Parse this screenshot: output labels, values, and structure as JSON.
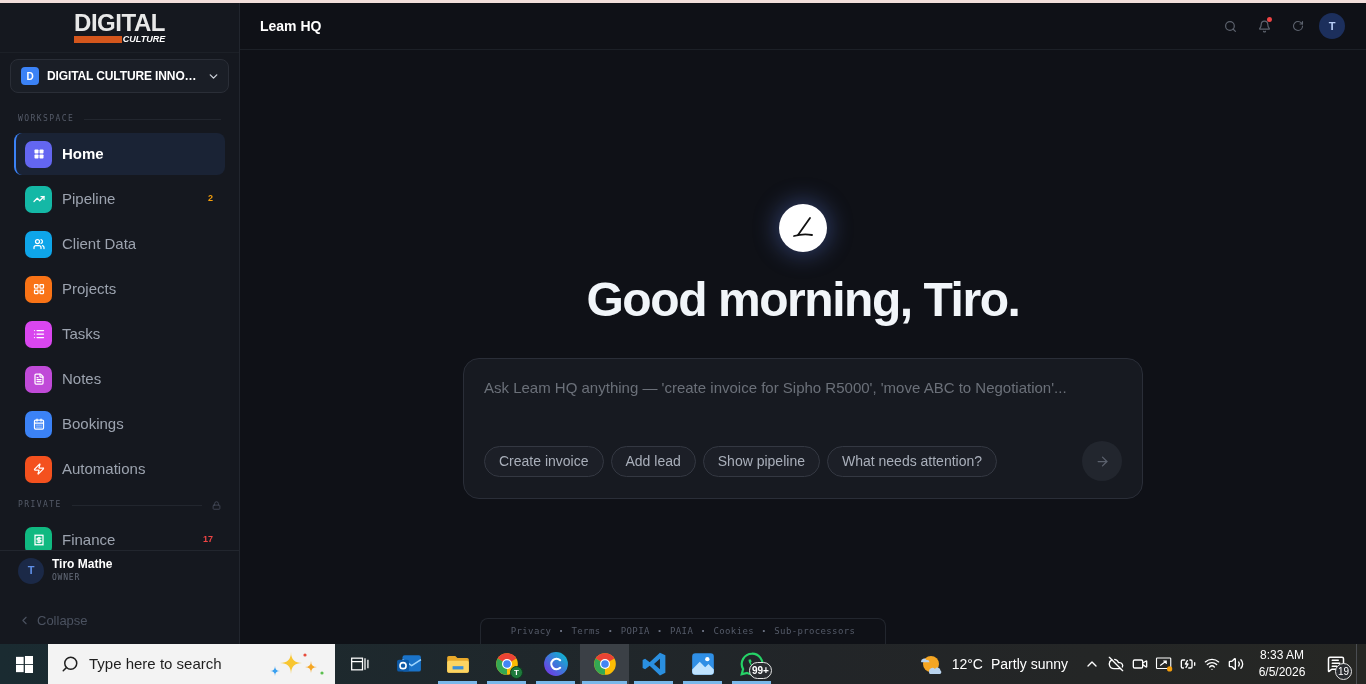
{
  "topbar": {
    "title": "Leam HQ",
    "unread": true,
    "avatar": "T"
  },
  "sidebar": {
    "logo": {
      "wordmark": "DIGITAL",
      "tagline": "CULTURE"
    },
    "workspace": {
      "initial": "D",
      "name": "DIGITAL CULTURE INNO…"
    },
    "sections": [
      {
        "label": "WORKSPACE",
        "locked": false,
        "items": [
          {
            "label": "Home",
            "selected": true,
            "color": "#6366f1"
          },
          {
            "label": "Pipeline",
            "selected": false,
            "color": "#14b8a6",
            "badge": {
              "text": "2",
              "color": "#f59e0b"
            }
          },
          {
            "label": "Client Data",
            "selected": false,
            "color": "#0ea5e9"
          },
          {
            "label": "Projects",
            "selected": false,
            "color": "#f97316"
          },
          {
            "label": "Tasks",
            "selected": false,
            "color": "#d946ef"
          },
          {
            "label": "Notes",
            "selected": false,
            "color": "#c04ad8"
          },
          {
            "label": "Bookings",
            "selected": false,
            "color": "#3b82f6"
          },
          {
            "label": "Automations",
            "selected": false,
            "color": "#f4511e"
          }
        ]
      },
      {
        "label": "PRIVATE",
        "locked": true,
        "items": [
          {
            "label": "Finance",
            "selected": false,
            "color": "#10b981",
            "badge": {
              "text": "17",
              "color": "#ef4444"
            }
          }
        ]
      }
    ],
    "user": {
      "initial": "T",
      "name": "Tiro Mathe",
      "role": "OWNER"
    },
    "collapse": "Collapse"
  },
  "main": {
    "greeting": "Good morning, Tiro.",
    "prompt": {
      "placeholder": "Ask Leam HQ anything — 'create invoice for Sipho R5000', 'move ABC to Negotiation'...",
      "suggestions": [
        "Create invoice",
        "Add lead",
        "Show pipeline",
        "What needs attention?"
      ]
    },
    "footer": {
      "separator": "·",
      "links": [
        "Privacy",
        "Terms",
        "POPIA",
        "PAIA",
        "Cookies",
        "Sub-processors"
      ]
    }
  },
  "taskbar": {
    "search_placeholder": "Type here to search",
    "apps": [
      {
        "kind": "mail",
        "running": false,
        "selected": false
      },
      {
        "kind": "files",
        "running": true,
        "selected": false
      },
      {
        "kind": "browser",
        "running": true,
        "selected": false,
        "profile": "T"
      },
      {
        "kind": "design",
        "running": true,
        "selected": false
      },
      {
        "kind": "browser",
        "running": true,
        "selected": true
      },
      {
        "kind": "editor",
        "running": true,
        "selected": false
      },
      {
        "kind": "photos",
        "running": true,
        "selected": false
      },
      {
        "kind": "chat",
        "running": true,
        "selected": false,
        "badge": "99+"
      }
    ],
    "weather": {
      "temperature": "12°C",
      "condition": "Partly sunny"
    },
    "clock": {
      "time": "8:33 AM",
      "date": "6/5/2026"
    },
    "notifications": "19"
  }
}
